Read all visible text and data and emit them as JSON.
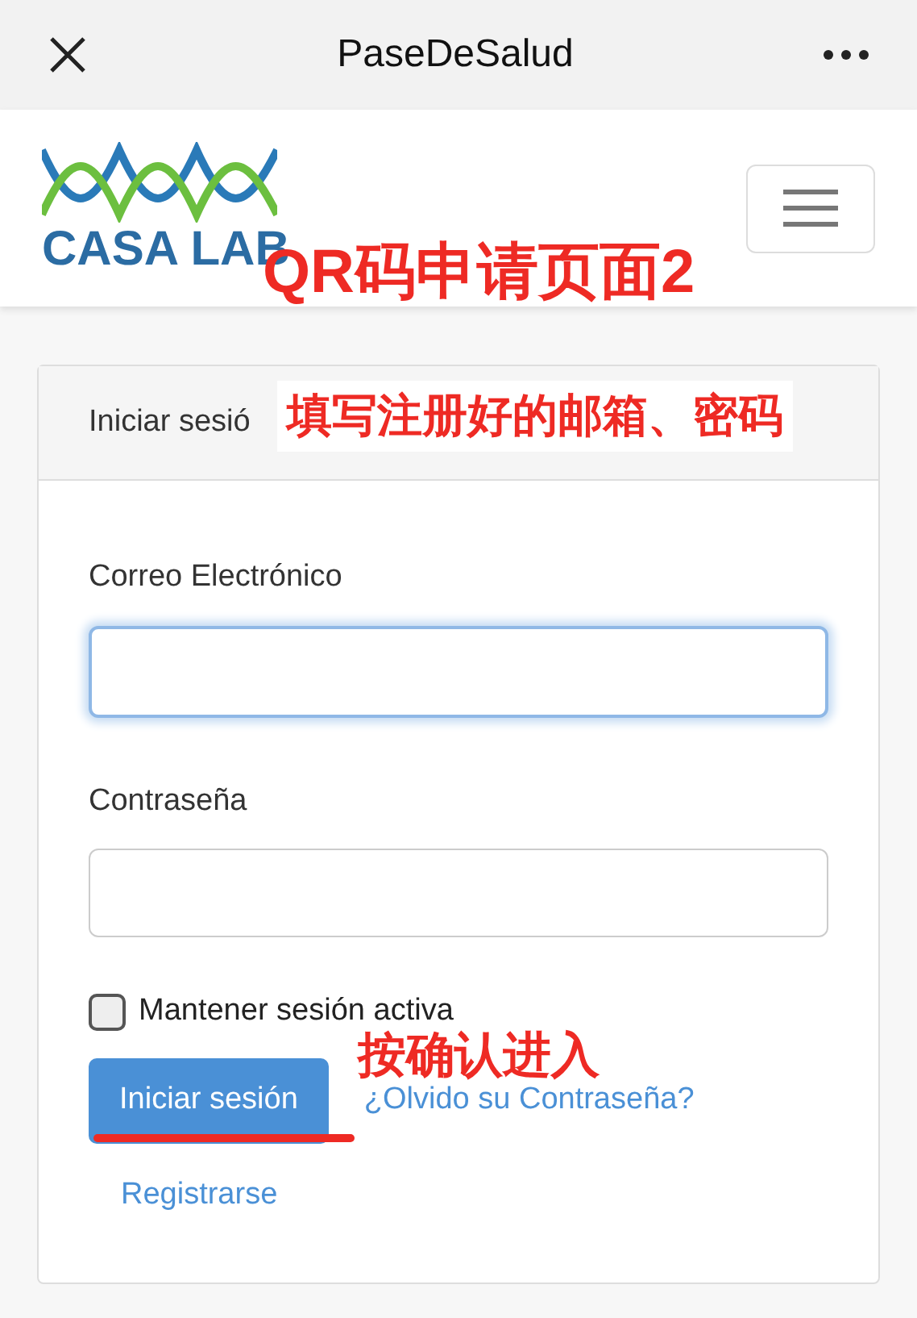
{
  "top_bar": {
    "title": "PaseDeSalud"
  },
  "navbar": {
    "logo_text": "CASA LAB"
  },
  "card": {
    "header": "Iniciar sesió",
    "email": {
      "label": "Correo Electrónico",
      "focused": true
    },
    "password": {
      "label": "Contraseña",
      "focused": false
    },
    "remember": {
      "label": "Mantener sesión activa",
      "checked": false
    },
    "submit": "Iniciar sesión",
    "forgot_link": "¿Olvido su Contraseña?",
    "register_link": "Registrarse"
  },
  "annotations": [
    {
      "kind": "title",
      "text": "QR码申请页面2"
    },
    {
      "kind": "boxed",
      "text": "填写注册好的邮箱、密码"
    },
    {
      "kind": "underlined",
      "text": "按确认进入"
    }
  ]
}
